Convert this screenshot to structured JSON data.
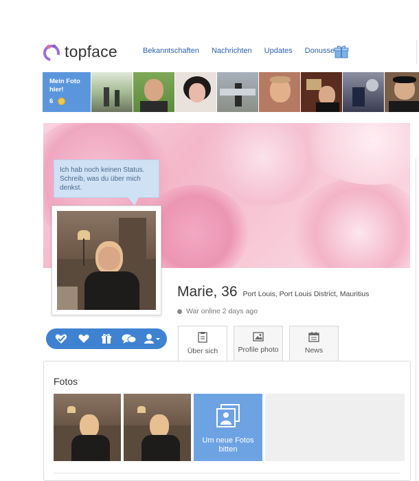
{
  "header": {
    "logo_text": "topface",
    "nav": [
      "Bekanntschaften",
      "Nachrichten",
      "Updates",
      "Donusse"
    ]
  },
  "strip": {
    "mein_label": "Mein Foto hier!",
    "count": "6"
  },
  "status_bubble": "Ich hab noch keinen Status. Schreib, was du über mich denkst.",
  "profile": {
    "name": "Marie, 36",
    "location": "Port Louis, Port Louis District, Mauritius",
    "online": "War online 2 days ago"
  },
  "tabs": [
    {
      "label": "Über sich",
      "icon": "document-icon"
    },
    {
      "label": "Profile photo",
      "icon": "image-icon"
    },
    {
      "label": "News",
      "icon": "calendar-icon"
    }
  ],
  "actions": [
    "like-check-icon",
    "heart-icon",
    "gift-icon",
    "chat-icon",
    "user-menu-icon"
  ],
  "panel": {
    "title": "Fotos",
    "new_photo_label": "Um neue Fotos bitten"
  },
  "colors": {
    "accent": "#3f82d1",
    "link": "#2d62b0",
    "bubble": "#cfe1f4"
  }
}
